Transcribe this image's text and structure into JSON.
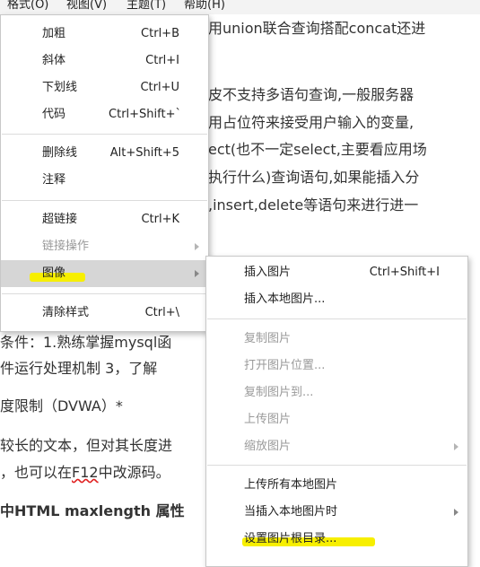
{
  "menubar": {
    "format": "格式(O)",
    "view": "视图(V)",
    "theme": "主题(T)",
    "help": "帮助(H)"
  },
  "document": {
    "line1": "用union联合查询搭配concat还进",
    "line2": "皮不支持多语句查询,一般服务器",
    "line3": "用占位符来接受用户输入的变量,",
    "line4": "ect(也不一定select,主要看应用场",
    "line5": "执行什么)查询语句,如果能插入分",
    "line6": ",insert,delete等语句来进行进一",
    "line7": "条件：1.熟练掌握mysql函",
    "line8": "件运行处理机制  3，了解",
    "line9": "度限制（DVWA）*",
    "line10": "较长的文本，但对其长度进",
    "line11_pre": "，也可以在",
    "line11_sq": "F12",
    "line11_post": "中改源码。",
    "line12_pre": "中",
    "line12_bold": "HTML maxlength 属性"
  },
  "format_menu": {
    "bold": {
      "label": "加粗",
      "shortcut": "Ctrl+B"
    },
    "italic": {
      "label": "斜体",
      "shortcut": "Ctrl+I"
    },
    "underline": {
      "label": "下划线",
      "shortcut": "Ctrl+U"
    },
    "code": {
      "label": "代码",
      "shortcut": "Ctrl+Shift+`"
    },
    "strikethrough": {
      "label": "删除线",
      "shortcut": "Alt+Shift+5"
    },
    "comment": {
      "label": "注释"
    },
    "hyperlink": {
      "label": "超链接",
      "shortcut": "Ctrl+K"
    },
    "link_ops": {
      "label": "链接操作"
    },
    "image": {
      "label": "图像"
    },
    "clear_style": {
      "label": "清除样式",
      "shortcut": "Ctrl+\\"
    }
  },
  "image_menu": {
    "insert_image": {
      "label": "插入图片",
      "shortcut": "Ctrl+Shift+I"
    },
    "insert_local": {
      "label": "插入本地图片..."
    },
    "copy_image": {
      "label": "复制图片"
    },
    "open_location": {
      "label": "打开图片位置..."
    },
    "copy_to": {
      "label": "复制图片到..."
    },
    "upload": {
      "label": "上传图片"
    },
    "scale": {
      "label": "缩放图片"
    },
    "upload_all": {
      "label": "上传所有本地图片"
    },
    "when_insert": {
      "label": "当插入本地图片时"
    },
    "set_root": {
      "label": "设置图片根目录..."
    }
  },
  "colors": {
    "highlight": "#f7ef00",
    "selected_bg": "#d6d6d6",
    "disabled_text": "#9a9a9a"
  }
}
